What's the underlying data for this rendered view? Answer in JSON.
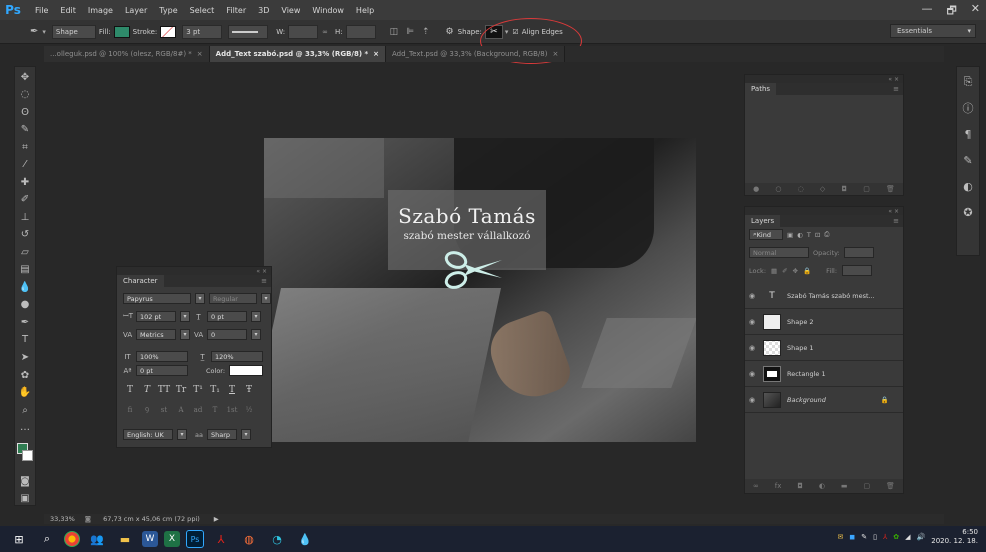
{
  "app": {
    "logo": "Ps",
    "menu": [
      "File",
      "Edit",
      "Image",
      "Layer",
      "Type",
      "Select",
      "Filter",
      "3D",
      "View",
      "Window",
      "Help"
    ],
    "window_controls": [
      "—",
      "🗗",
      "✕"
    ]
  },
  "options_bar": {
    "tool_mode": "Shape",
    "fill_label": "Fill:",
    "stroke_label": "Stroke:",
    "stroke_width": "3 pt",
    "w_label": "W:",
    "h_label": "H:",
    "shape_label": "Shape:",
    "align_edges_label": "Align Edges",
    "workspace": "Essentials"
  },
  "doc_tabs": [
    {
      "label": "...olleguk.psd @ 100% (olesz, RGB/8#) *",
      "active": false
    },
    {
      "label": "Add_Text szabó.psd @ 33,3% (RGB/8) *",
      "active": true
    },
    {
      "label": "Add_Text.psd @ 33,3% (Background, RGB/8)",
      "active": false
    }
  ],
  "canvas": {
    "title_name": "Szabó Tamás",
    "title_sub": "szabó mester vállalkozó",
    "scissors_color": "#cdeee8",
    "rect_color": "#7a7a7a"
  },
  "character_panel": {
    "tab": "Character",
    "font_family": "Papyrus",
    "font_style": "Regular",
    "font_size": "102 pt",
    "leading": "0 pt",
    "kerning": "Metrics",
    "tracking": "0",
    "vertical_scale": "100%",
    "horizontal_scale": "120%",
    "baseline_shift": "0 pt",
    "color_label": "Color:",
    "type_styles": [
      "T",
      "T",
      "TT",
      "Tr",
      "T¹",
      "T₁",
      "T",
      "Ŧ"
    ],
    "opentype": [
      "fi",
      "ꝯ",
      "st",
      "A",
      "ad",
      "T",
      "1st",
      "½"
    ],
    "language": "English: UK",
    "aa_label": "aa",
    "antialias": "Sharp"
  },
  "paths_panel": {
    "tab": "Paths"
  },
  "layers_panel": {
    "tab": "Layers",
    "filter_kind": "Kind",
    "blend_mode": "Normal",
    "opacity_label": "Opacity:",
    "lock_label": "Lock:",
    "fill_label": "Fill:",
    "layers": [
      {
        "name": "Szabó Tamás szabó mest...",
        "kind": "text"
      },
      {
        "name": "Shape 2",
        "kind": "shape"
      },
      {
        "name": "Shape 1",
        "kind": "shape"
      },
      {
        "name": "Rectangle 1",
        "kind": "rect"
      },
      {
        "name": "Background",
        "kind": "bg"
      }
    ]
  },
  "status_bar": {
    "zoom": "33,33%",
    "doc_size": "67,73 cm x 45,06 cm (72 ppi)"
  },
  "taskbar": {
    "time": "6:50",
    "date": "2020. 12. 18."
  },
  "colors": {
    "accent_ps": "#31a8ff",
    "highlight_circle": "#d93a3a",
    "foreground": "#2f7d52",
    "background": "#ffffff"
  }
}
